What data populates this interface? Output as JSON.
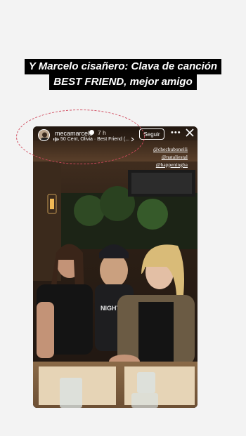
{
  "headline": {
    "line1": "Y Marcelo cisañero: Clava de canción",
    "line2": "BEST FRIEND, mejor amigo"
  },
  "story": {
    "username": "mecamarcelo",
    "time": "7 h",
    "music": "50 Cent, Olivia · Best Friend (...",
    "follow_label": "Seguir",
    "more_label": "•••",
    "mentions": [
      "@chechubonelli",
      "@nataliestal",
      "@happeningba"
    ]
  },
  "colors": {
    "page_bg": "#f3f3f3",
    "annotation_oval": "#d14a5e",
    "headline_bg": "#000000"
  },
  "icons": {
    "verified": "verified-badge-icon",
    "audio": "audio-wave-icon",
    "chevron": "chevron-right-icon",
    "close": "close-icon"
  }
}
